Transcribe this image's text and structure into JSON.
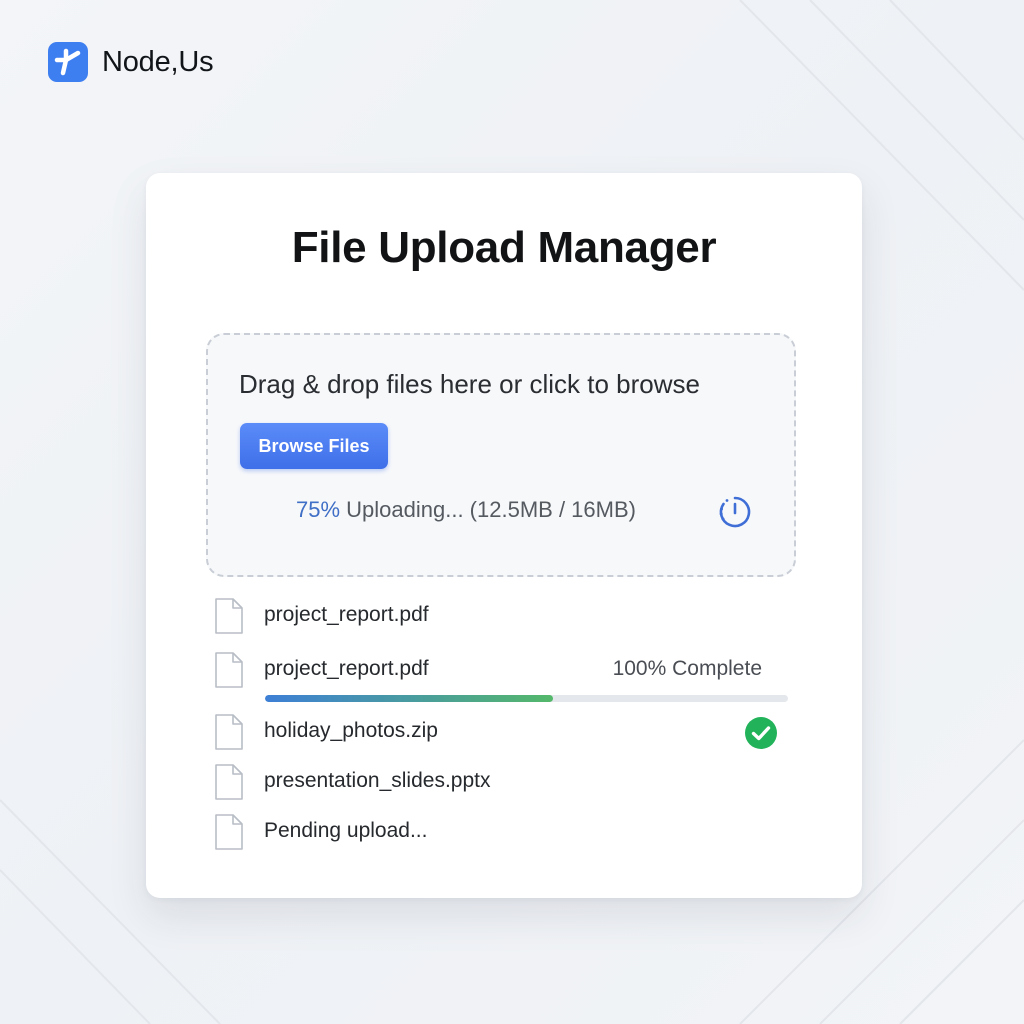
{
  "brand": {
    "name": "Node,Us",
    "logo_icon": "node-logo-icon",
    "logo_color": "#3d7ef0"
  },
  "card": {
    "title": "File Upload Manager"
  },
  "dropzone": {
    "prompt": "Drag & drop files here or click to browse",
    "browse_label": "Browse Files",
    "progress_percent": "75%",
    "progress_text": " Uploading... (12.5MB / 16MB)",
    "status_icon": "timer-icon"
  },
  "files": [
    {
      "name": "project_report.pdf",
      "icon": "file-icon"
    },
    {
      "name": "project_report.pdf",
      "status": "100% Complete",
      "progress": 0.55,
      "icon": "file-icon"
    },
    {
      "name": "holiday_photos.zip",
      "status_icon": "check-circle-icon",
      "icon": "file-icon"
    },
    {
      "name": "presentation_slides.pptx",
      "icon": "file-icon"
    },
    {
      "name": "Pending upload...",
      "icon": "file-icon"
    }
  ],
  "colors": {
    "accent": "#4a7cf0",
    "success": "#22b35a",
    "progress_start": "#3d7fd6",
    "progress_end": "#54b86a"
  }
}
